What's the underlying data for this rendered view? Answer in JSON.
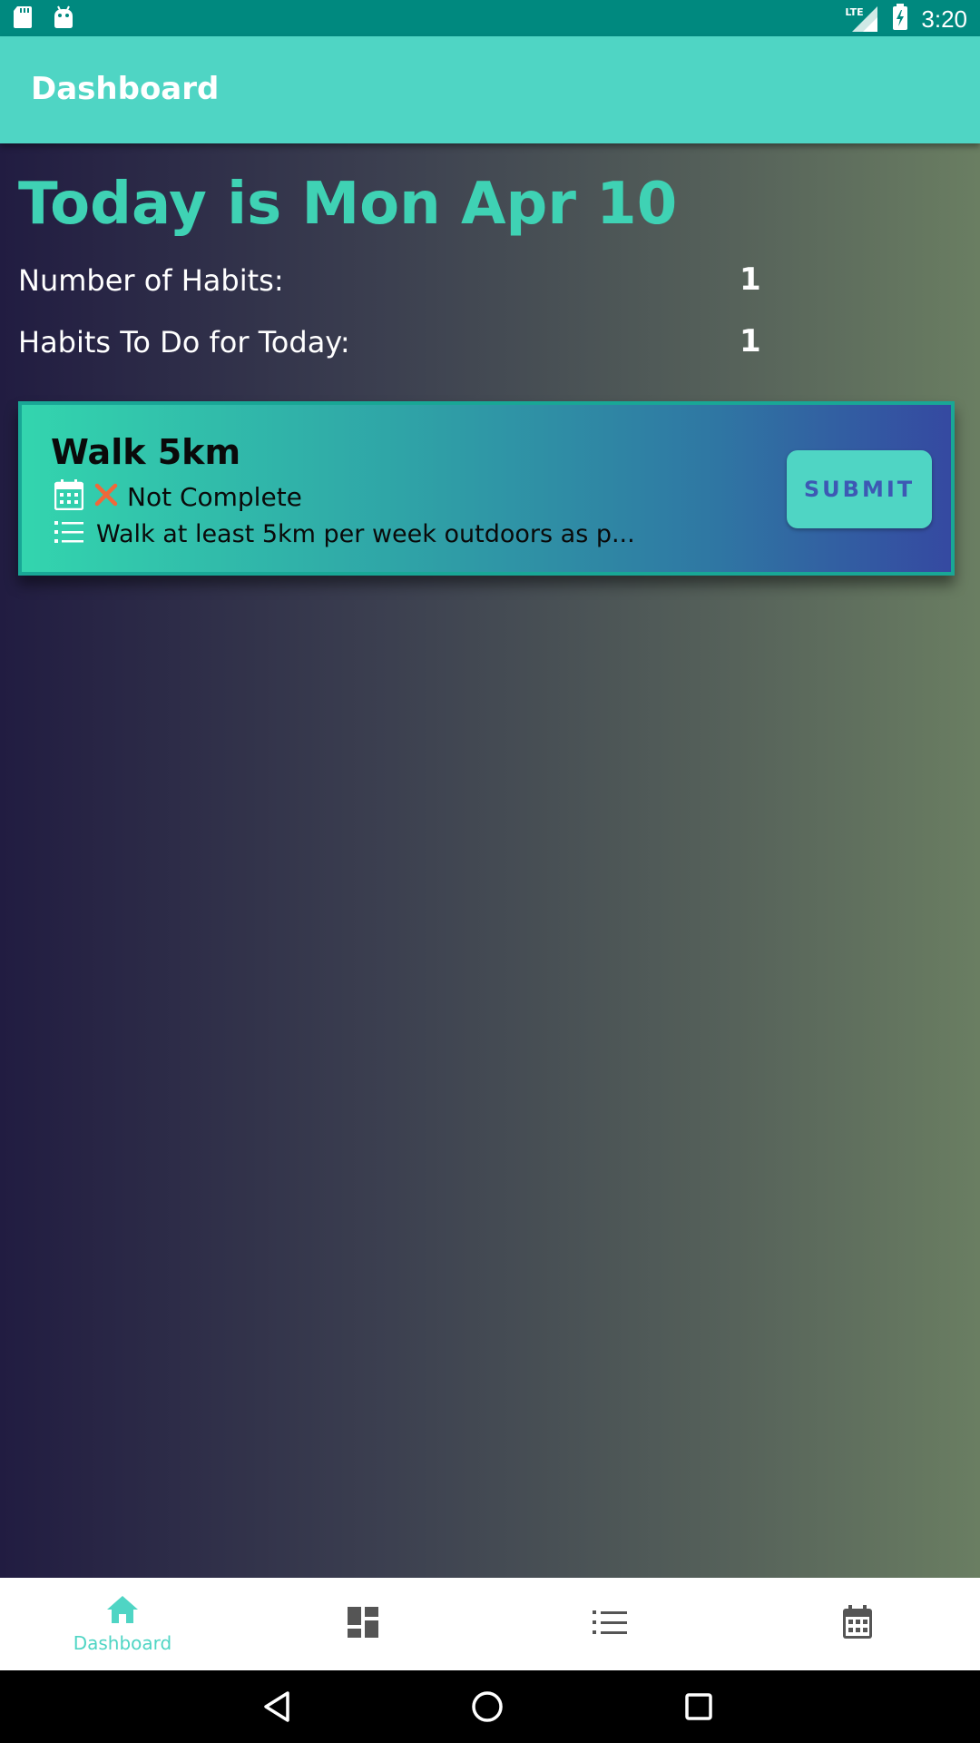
{
  "status_bar": {
    "time": "3:20",
    "network_label": "LTE",
    "left_icons": [
      "sd-card-icon",
      "android-icon"
    ],
    "right_icons": [
      "lte-signal-icon",
      "battery-charging-icon"
    ]
  },
  "app_bar": {
    "title": "Dashboard"
  },
  "summary": {
    "today_heading": "Today is Mon Apr 10",
    "habits_count_label": "Number of Habits:",
    "habits_count_value": "1",
    "habits_today_label": "Habits To Do for Today:",
    "habits_today_value": "1"
  },
  "habits": [
    {
      "name": "Walk 5km",
      "status": "Not Complete",
      "description": "Walk at least 5km per week outdoors as p...",
      "submit_label": "SUBMIT",
      "status_icon": "close-icon",
      "status_color": "#f0683a"
    }
  ],
  "bottom_nav": {
    "items": [
      {
        "label": "Dashboard",
        "icon": "home-icon",
        "active": true
      },
      {
        "label": "",
        "icon": "dashboard-grid-icon",
        "active": false
      },
      {
        "label": "",
        "icon": "list-icon",
        "active": false
      },
      {
        "label": "",
        "icon": "calendar-icon",
        "active": false
      }
    ]
  },
  "colors": {
    "accent": "#4fd5c4",
    "heading": "#3fd2b4",
    "status_bar": "#00897f",
    "submit_text": "#3d59b4",
    "inactive_icon": "#555555"
  }
}
